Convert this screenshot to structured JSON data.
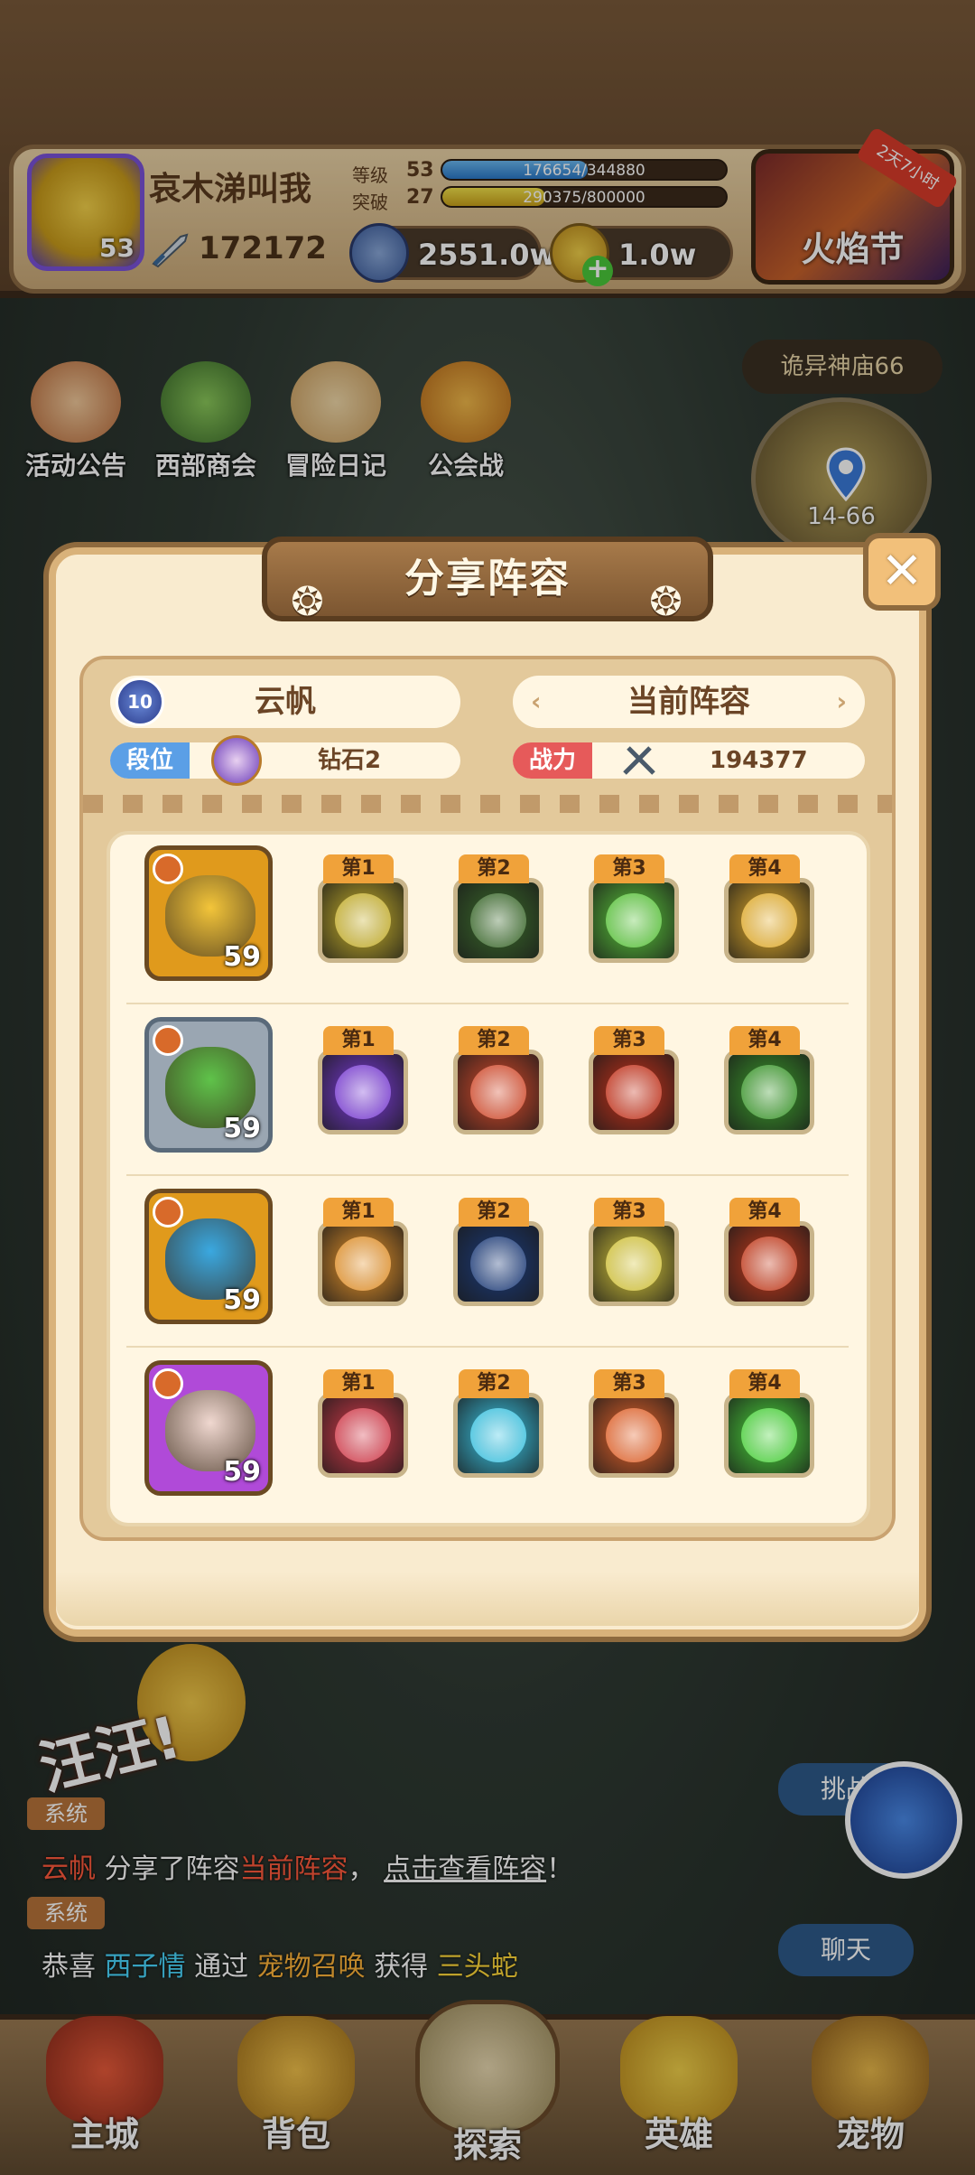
{
  "player": {
    "name": "哀木涕叫我",
    "avatar_level": "53",
    "power": "172172",
    "level_label": "等级",
    "level_value": "53",
    "level_exp": "176654/344880",
    "level_fill": 0.512,
    "break_label": "突破",
    "break_value": "27",
    "break_exp": "290375/800000",
    "break_fill": 0.363
  },
  "currency": {
    "silver": "2551.0w",
    "gold": "1.0w"
  },
  "event": {
    "label": "火焰节",
    "countdown": "2天7小时"
  },
  "side_menu": [
    {
      "label": "活动公告",
      "icon": "notice-icon"
    },
    {
      "label": "西部商会",
      "icon": "merchant-icon"
    },
    {
      "label": "冒险日记",
      "icon": "diary-icon"
    },
    {
      "label": "公会战",
      "icon": "guild-war-icon"
    }
  ],
  "stage": {
    "title": "诡异神庙66",
    "number": "14-66"
  },
  "modal": {
    "title": "分享阵容",
    "player_name": "云帆",
    "player_level": "10",
    "formation_name": "当前阵容",
    "rank_label": "段位",
    "rank_value": "钻石2",
    "power_label": "战力",
    "power_value": "194377"
  },
  "lineup": [
    {
      "level": "59",
      "hero_color": "#f3c53a",
      "frame": "#e09a1c",
      "skills": [
        {
          "rank": "第1",
          "color": "#c9b22a"
        },
        {
          "rank": "第2",
          "color": "#3a6a2a"
        },
        {
          "rank": "第3",
          "color": "#5ac83a"
        },
        {
          "rank": "第4",
          "color": "#e8b02a"
        }
      ]
    },
    {
      "level": "59",
      "hero_color": "#5fc34a",
      "frame": "#9aa6b2",
      "skills": [
        {
          "rank": "第1",
          "color": "#7a3ad8"
        },
        {
          "rank": "第2",
          "color": "#d84a2a"
        },
        {
          "rank": "第3",
          "color": "#c8321a"
        },
        {
          "rank": "第4",
          "color": "#3a9a2a"
        }
      ]
    },
    {
      "level": "59",
      "hero_color": "#3aa8e0",
      "frame": "#e09a1c",
      "skills": [
        {
          "rank": "第1",
          "color": "#e8942a"
        },
        {
          "rank": "第2",
          "color": "#1a3a7a"
        },
        {
          "rank": "第3",
          "color": "#d8c83a"
        },
        {
          "rank": "第4",
          "color": "#c83a1a"
        }
      ]
    },
    {
      "level": "59",
      "hero_color": "#f0d8d0",
      "frame": "#b04ad8",
      "skills": [
        {
          "rank": "第1",
          "color": "#d83a4a"
        },
        {
          "rank": "第2",
          "color": "#3ac8e8"
        },
        {
          "rank": "第3",
          "color": "#e8642a"
        },
        {
          "rank": "第4",
          "color": "#4ad83a"
        }
      ]
    }
  ],
  "chat": {
    "tag": "系统",
    "msg1": {
      "user": "云帆",
      "text1": "分享了阵容",
      "formation": "当前阵容",
      "sep": "，",
      "link": "点击查看阵容",
      "end": "！"
    },
    "msg2": {
      "w1": "恭喜",
      "user": "西子情",
      "w2": "通过",
      "method": "宠物召唤",
      "w3": "获得",
      "item": "三头蛇"
    },
    "challenge": "挑战",
    "chat_btn": "聊天"
  },
  "bubble": "汪汪!",
  "nav": [
    {
      "label": "主城",
      "icon": "castle-icon"
    },
    {
      "label": "背包",
      "icon": "backpack-icon"
    },
    {
      "label": "探索",
      "icon": "explore-icon"
    },
    {
      "label": "英雄",
      "icon": "hero-icon"
    },
    {
      "label": "宠物",
      "icon": "pet-icon"
    }
  ],
  "colors": {
    "accent": "#f0a23a",
    "modal_bg": "#f9ebcf",
    "title_bg": "#8e6a3e"
  }
}
